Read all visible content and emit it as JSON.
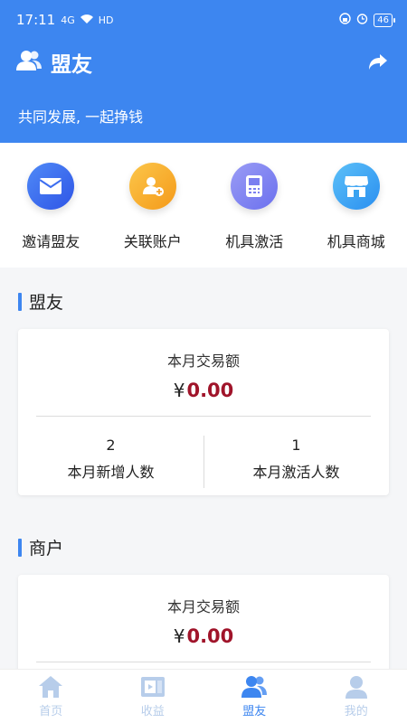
{
  "status_bar": {
    "time": "17:11",
    "signal": "4G",
    "network": "HD",
    "battery": "46"
  },
  "header": {
    "title": "盟友",
    "slogan": "共同发展, 一起挣钱"
  },
  "quick_actions": [
    {
      "label": "邀请盟友",
      "icon": "mail-icon",
      "color": "#3d6ef0"
    },
    {
      "label": "关联账户",
      "icon": "user-add-icon",
      "color": "#f7a623"
    },
    {
      "label": "机具激活",
      "icon": "pos-terminal-icon",
      "color": "#7b7ff0"
    },
    {
      "label": "机具商城",
      "icon": "store-icon",
      "color": "#3aa3f0"
    }
  ],
  "ally_section": {
    "title": "盟友",
    "amount_label": "本月交易额",
    "currency": "¥",
    "amount": "0.00",
    "stats": [
      {
        "value": "2",
        "label": "本月新增人数"
      },
      {
        "value": "1",
        "label": "本月激活人数"
      }
    ]
  },
  "merchant_section": {
    "title": "商户",
    "amount_label": "本月交易额",
    "currency": "¥",
    "amount": "0.00"
  },
  "tabbar": [
    {
      "label": "首页",
      "icon": "home-icon",
      "active": false
    },
    {
      "label": "收益",
      "icon": "wallet-icon",
      "active": false
    },
    {
      "label": "盟友",
      "icon": "friends-icon",
      "active": true
    },
    {
      "label": "我的",
      "icon": "profile-icon",
      "active": false
    }
  ],
  "colors": {
    "primary": "#3d86f0",
    "amount": "#a0142a"
  }
}
